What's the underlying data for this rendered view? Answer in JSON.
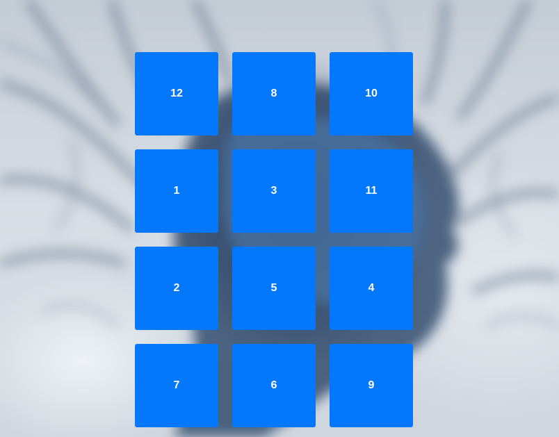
{
  "puzzle": {
    "tiles": [
      "12",
      "8",
      "10",
      "1",
      "3",
      "11",
      "2",
      "5",
      "4",
      "7",
      "6",
      "9"
    ]
  },
  "colors": {
    "tile_background": "#0478fd",
    "tile_text": "#ffffff"
  }
}
